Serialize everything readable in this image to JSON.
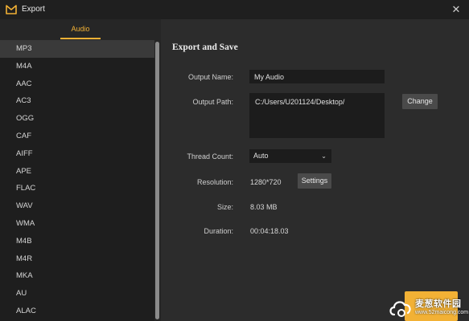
{
  "window": {
    "title": "Export",
    "close_icon": "close-icon"
  },
  "tabs": [
    {
      "label": "Audio",
      "active": true
    }
  ],
  "formats": [
    "MP3",
    "M4A",
    "AAC",
    "AC3",
    "OGG",
    "CAF",
    "AIFF",
    "APE",
    "FLAC",
    "WAV",
    "WMA",
    "M4B",
    "M4R",
    "MKA",
    "AU",
    "ALAC"
  ],
  "selected_format": "MP3",
  "export": {
    "section_title": "Export and Save",
    "output_name_label": "Output Name:",
    "output_name_value": "My Audio",
    "output_path_label": "Output Path:",
    "output_path_value": "C:/Users/U201124/Desktop/",
    "change_label": "Change",
    "thread_count_label": "Thread Count:",
    "thread_count_value": "Auto",
    "resolution_label": "Resolution:",
    "resolution_value": "1280*720",
    "settings_label": "Settings",
    "size_label": "Size:",
    "size_value": "8.03 MB",
    "duration_label": "Duration:",
    "duration_value": "00:04:18.03"
  },
  "watermark": {
    "text": "麦葱软件园",
    "url": "www.52maicong.com"
  },
  "colors": {
    "accent": "#f2b135",
    "background": "#2c2c2c",
    "list_bg": "#1e1e1e",
    "selected_row": "#3a3a3a"
  }
}
